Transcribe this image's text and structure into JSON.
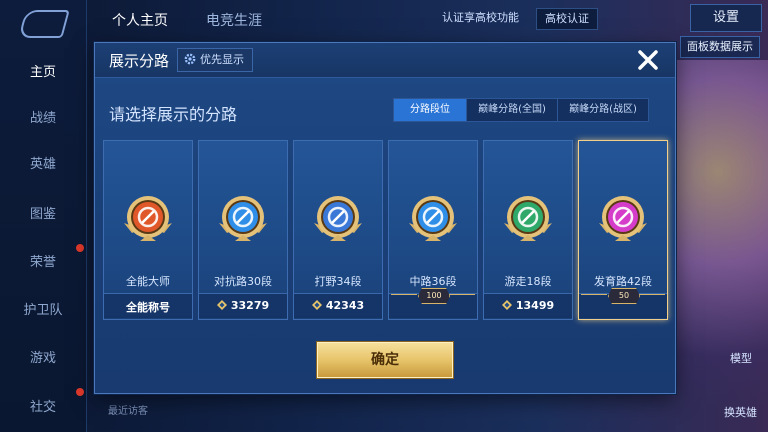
{
  "sidebar": {
    "items": [
      {
        "label": "主页",
        "active": true
      },
      {
        "label": "战绩",
        "active": false
      },
      {
        "label": "英雄",
        "active": false
      },
      {
        "label": "图鉴",
        "active": false
      },
      {
        "label": "荣誉",
        "active": false
      },
      {
        "label": "护卫队",
        "active": false
      },
      {
        "label": "游戏",
        "active": false
      },
      {
        "label": "社交",
        "active": false
      }
    ]
  },
  "header": {
    "tabs": [
      {
        "label": "个人主页",
        "active": true
      },
      {
        "label": "电竞生涯",
        "active": false
      }
    ],
    "verify_text": "认证享高校功能",
    "campus_badge": "高校认证",
    "settings_label": "设置",
    "right_button": "面板数据展示"
  },
  "background": {
    "visitor_text": "最近访客",
    "bottom_right": [
      "模型",
      "换英雄"
    ]
  },
  "modal": {
    "title": "展示分路",
    "priority_label": "优先显示",
    "subtitle": "请选择展示的分路",
    "filters": [
      {
        "label": "分路段位",
        "active": true
      },
      {
        "label": "巅峰分路(全国)",
        "active": false
      },
      {
        "label": "巅峰分路(战区)",
        "active": false
      }
    ],
    "cards": [
      {
        "name": "全能大师",
        "value": "全能称号",
        "icon": "all-round-emblem-icon",
        "color": "#e0582a",
        "has_points": false,
        "badge": "",
        "selected": false
      },
      {
        "name": "对抗路30段",
        "value": "33279",
        "icon": "clash-lane-emblem-icon",
        "color": "#2f8fe8",
        "has_points": true,
        "badge": "",
        "selected": false
      },
      {
        "name": "打野34段",
        "value": "42343",
        "icon": "jungle-emblem-icon",
        "color": "#3a78d8",
        "has_points": true,
        "badge": "",
        "selected": false
      },
      {
        "name": "中路36段",
        "value": "",
        "icon": "mid-lane-emblem-icon",
        "color": "#2f8fe8",
        "has_points": false,
        "badge": "100",
        "selected": false
      },
      {
        "name": "游走18段",
        "value": "13499",
        "icon": "roam-emblem-icon",
        "color": "#2fa96a",
        "has_points": true,
        "badge": "",
        "selected": false
      },
      {
        "name": "发育路42段",
        "value": "",
        "icon": "farm-lane-emblem-icon",
        "color": "#d43cc9",
        "has_points": false,
        "badge": "50",
        "selected": true
      }
    ],
    "confirm_label": "确定"
  },
  "colors": {
    "gold": "#e7c46a",
    "accent_blue": "#2a74d6",
    "modal_bg": "#1f4a86"
  }
}
